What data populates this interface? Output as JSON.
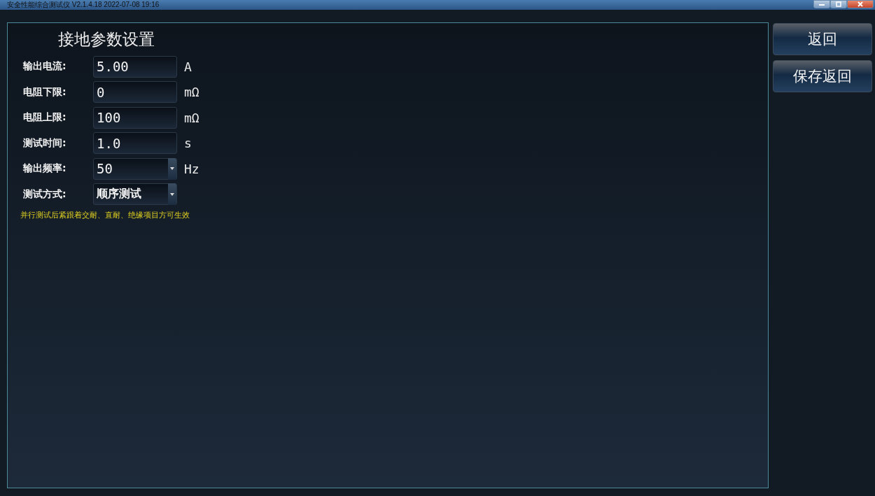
{
  "window": {
    "title": "安全性能综合测试仪 V2.1.4.18 2022-07-08 19:16"
  },
  "panel": {
    "title": "接地参数设置",
    "fields": [
      {
        "kind": "input",
        "label": "输出电流:",
        "value": "5.00",
        "unit": "A"
      },
      {
        "kind": "input",
        "label": "电阻下限:",
        "value": "0",
        "unit": "mΩ"
      },
      {
        "kind": "input",
        "label": "电阻上限:",
        "value": "100",
        "unit": "mΩ"
      },
      {
        "kind": "input",
        "label": "测试时间:",
        "value": "1.0",
        "unit": "s"
      },
      {
        "kind": "select",
        "label": "输出频率:",
        "value": "50",
        "unit": "Hz"
      },
      {
        "kind": "select",
        "label": "测试方式:",
        "value": "顺序测试"
      }
    ],
    "note": "并行测试后紧跟着交耐、直耐、绝缘项目方可生效"
  },
  "buttons": [
    "返回",
    "保存返回"
  ]
}
